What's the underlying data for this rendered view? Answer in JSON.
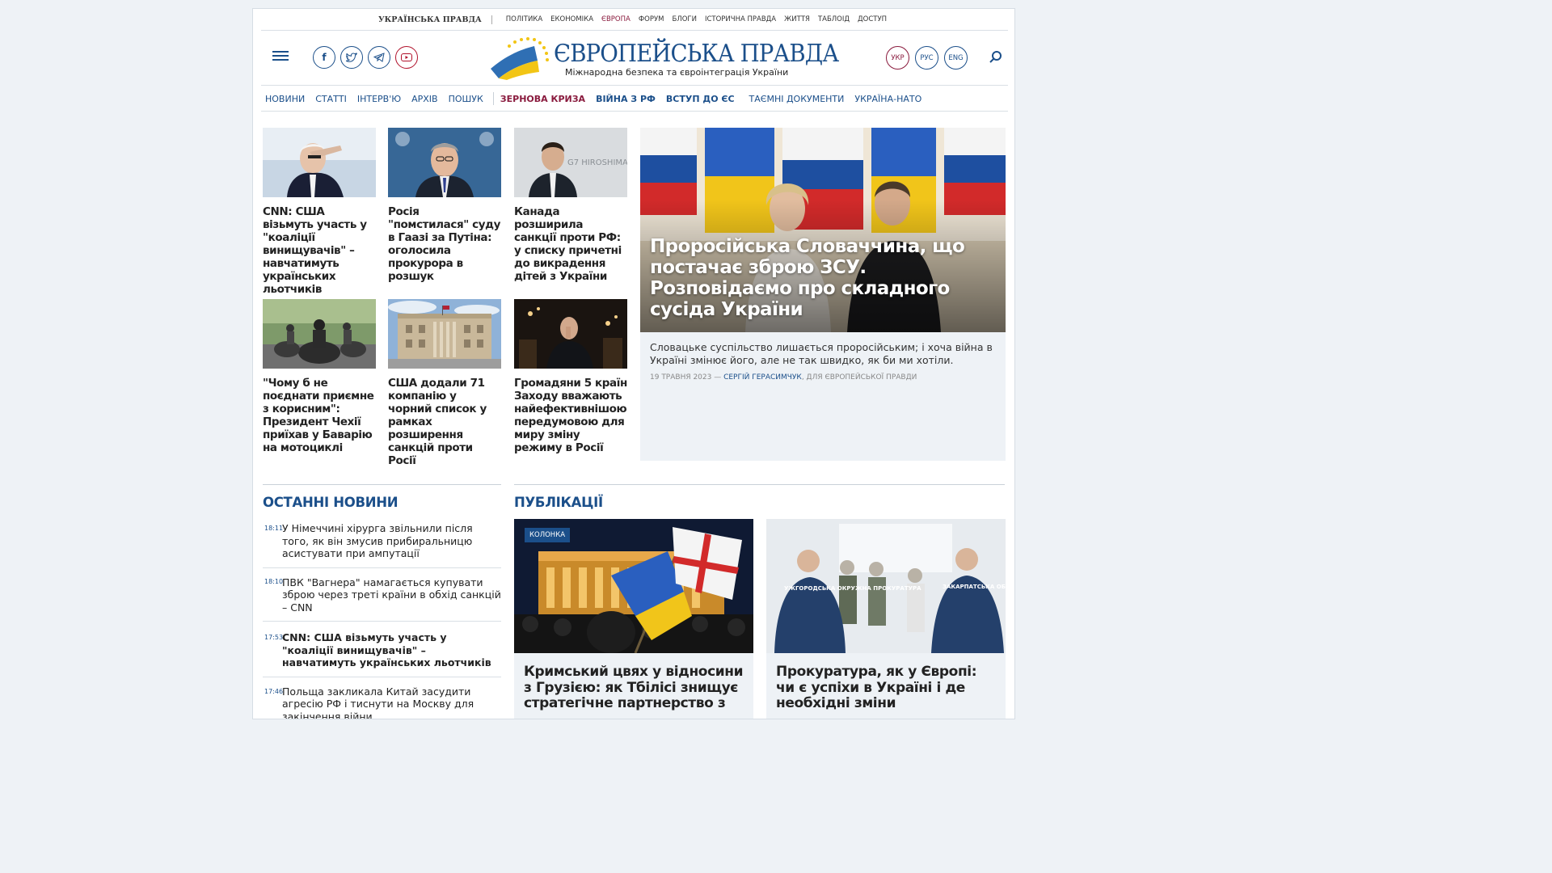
{
  "topstrip": {
    "brand": "УКРАЇНСЬКА ПРАВДА",
    "links": [
      "ПОЛІТИКА",
      "ЕКОНОМІКА",
      "ЄВРОПА",
      "ФОРУМ",
      "БЛОГИ",
      "ІСТОРИЧНА ПРАВДА",
      "ЖИТТЯ",
      "ТАБЛОІД",
      "ДОСТУП"
    ]
  },
  "header": {
    "logo_title": "ЄВРОПЕЙСЬКА ПРАВДА",
    "logo_subtitle": "Міжнародна безпека та євроінтеграція України",
    "social": [
      "facebook-icon",
      "twitter-icon",
      "telegram-icon",
      "youtube-icon"
    ],
    "languages": [
      "УКР",
      "РУС",
      "ENG"
    ],
    "colors": {
      "brand_blue": "#1b4f8a",
      "accent_red": "#8a1b3e"
    }
  },
  "nav": {
    "items": [
      "НОВИНИ",
      "СТАТТІ",
      "ІНТЕРВ'Ю",
      "АРХІВ",
      "ПОШУК"
    ],
    "hot": [
      "ЗЕРНОВА КРИЗА",
      "ВІЙНА З РФ",
      "ВСТУП ДО ЄС",
      "ТАЄМНІ ДОКУМЕНТИ",
      "УКРАЇНА-НАТО"
    ]
  },
  "cards": [
    {
      "title": "CNN: США візьмуть участь у \"коаліції винищувачів\" – навчатимуть українських льотчиків"
    },
    {
      "title": "Росія \"помстилася\" суду в Гаазі за Путіна: оголосила прокурора в розшук"
    },
    {
      "title": "Канада розширила санкції проти РФ: у списку причетні до викрадення дітей з України"
    },
    {
      "title": "\"Чому б не поєднати приємне з корисним\": Президент Чехії приїхав у Баварію на мотоциклі"
    },
    {
      "title": "США додали 71 компанію у чорний список у рамках розширення санкцій проти Росії"
    },
    {
      "title": "Громадяни 5 країн Заходу вважають найефективнішою передумовою для миру зміну режиму в Росії"
    }
  ],
  "card3_image_text": "G7 HIROSHIMA",
  "feature": {
    "title": "Проросійська Словаччина, що постачає зброю ЗСУ. Розповідаємо про складного сусіда України",
    "lead": "Словацьке суспільство лишається проросійським; і хоча війна в Україні змінює його, але не так швидко, як би ми хотіли.",
    "date": "19 ТРАВНЯ 2023 — ",
    "author": "СЕРГІЙ ГЕРАСИМЧУК",
    "source": ", ДЛЯ ЄВРОПЕЙСЬКОЇ ПРАВДИ"
  },
  "latest": {
    "title": "ОСТАННІ НОВИНИ",
    "items": [
      {
        "time": "18:11",
        "text": "У Німеччині хірурга звільнили після того, як він змусив прибиральницю асистувати при ампутації"
      },
      {
        "time": "18:10",
        "text": "ПВК \"Вагнера\" намагається купувати зброю через треті країни в обхід санкцій – CNN"
      },
      {
        "time": "17:53",
        "text": "CNN: США візьмуть участь у \"коаліції винищувачів\" – навчатимуть українських льотчиків"
      },
      {
        "time": "17:46",
        "text": "Польща закликала Китай засудити агресію РФ і тиснути на Москву для закінчення війни"
      }
    ]
  },
  "pubs": {
    "title": "ПУБЛІКАЦІЇ",
    "items": [
      {
        "badge": "КОЛОНКА",
        "title": "Кримський цвях у відносини з Грузією: як Тбілісі знищує стратегічне партнерство з"
      },
      {
        "title": "Прокуратура, як у Європі: чи є успіхи в Україні і де необхідні зміни",
        "vest_left": "УЖГОРОДСЬКА ОКРУЖНА ПРОКУРАТУРА",
        "vest_right": "ЗАКАРПАТСЬКА ОБЛАСНА ПРОКУРАТУРА"
      }
    ]
  }
}
